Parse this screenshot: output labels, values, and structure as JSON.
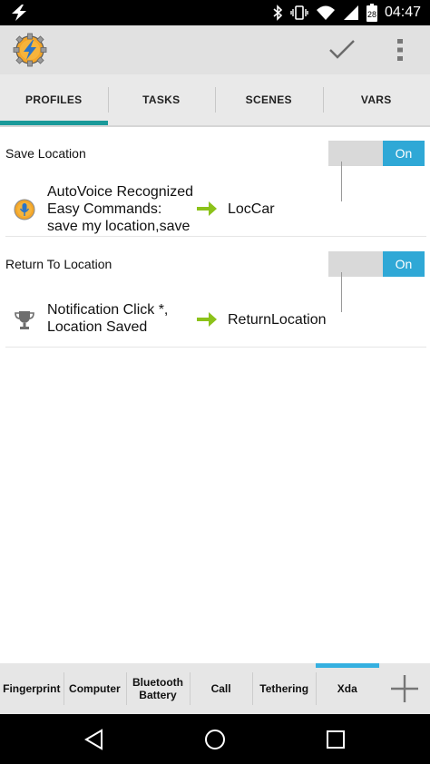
{
  "status_bar": {
    "time": "04:47",
    "battery_level": "28",
    "icons": [
      "lightning-icon",
      "bluetooth-icon",
      "vibrate-icon",
      "wifi-icon",
      "signal-icon",
      "battery-icon"
    ]
  },
  "action_bar": {
    "logo_icon": "tasker-logo-icon",
    "confirm_icon": "check-icon",
    "overflow_icon": "overflow-menu-icon"
  },
  "tabs": [
    {
      "label": "PROFILES",
      "active": true
    },
    {
      "label": "TASKS",
      "active": false
    },
    {
      "label": "SCENES",
      "active": false
    },
    {
      "label": "VARS",
      "active": false
    }
  ],
  "profiles": [
    {
      "name": "Save Location",
      "toggle": "On",
      "context_icon": "autovoice-microphone-icon",
      "context": "AutoVoice Recognized\nEasy Commands:\nsave my location,save",
      "task": "LocCar"
    },
    {
      "name": "Return To Location",
      "toggle": "On",
      "context_icon": "trophy-icon",
      "context": "Notification Click *,\nLocation Saved",
      "task": "ReturnLocation"
    }
  ],
  "projects": [
    {
      "label": "Fingerprint",
      "active": false
    },
    {
      "label": "Computer",
      "active": false
    },
    {
      "label": "Bluetooth\nBattery",
      "active": false
    },
    {
      "label": "Call",
      "active": false
    },
    {
      "label": "Tethering",
      "active": false
    },
    {
      "label": "Xda",
      "active": true
    }
  ],
  "colors": {
    "active_tab": "#1a9a9a",
    "toggle_on": "#2fa8d6",
    "arrow": "#8cc21a",
    "active_project": "#35b0e0"
  }
}
